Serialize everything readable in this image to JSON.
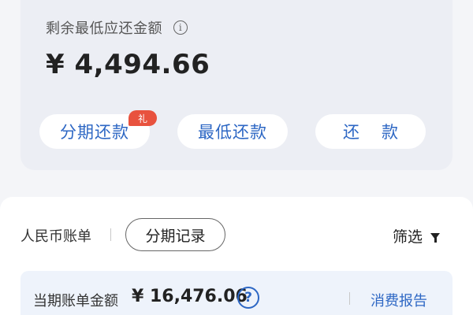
{
  "balance_card": {
    "min_due_label": "剩余最低应还金额",
    "amount": "¥ 4,494.66",
    "info_icon": "i",
    "buttons": {
      "installment": "分期还款",
      "minimum": "最低还款",
      "repay": "还款"
    },
    "gift_badge": "礼"
  },
  "bill_section": {
    "currency_label": "人民币账单",
    "installment_record": "分期记录",
    "filter_label": "筛选"
  },
  "summary": {
    "label": "当期账单金额",
    "amount": "¥ 16,476.06",
    "help_icon": "?",
    "report_link": "消费报告"
  },
  "colors": {
    "accent": "#2d67c4",
    "badge": "#e8523e",
    "card_bg": "#eceef4",
    "summary_bg": "#eef3fb"
  },
  "icons": [
    "info-icon",
    "filter-icon",
    "help-icon"
  ]
}
